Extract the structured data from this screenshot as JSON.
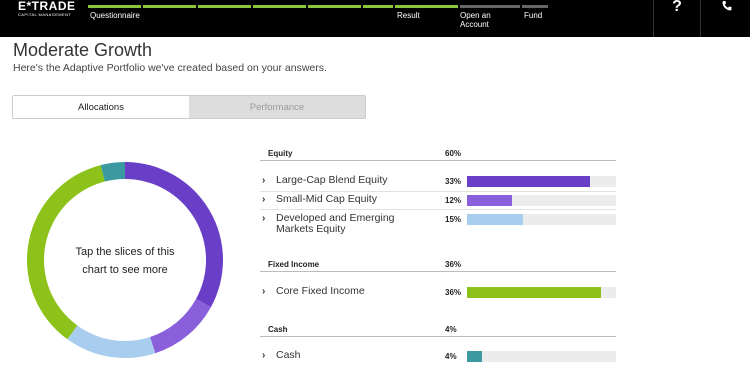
{
  "brand": {
    "name": "E*TRADE",
    "sub": "CAPITAL MANAGEMENT"
  },
  "progress": {
    "steps": [
      {
        "label": "Questionnaire",
        "state": "complete"
      },
      {
        "label": "Result",
        "state": "complete"
      },
      {
        "label": "Open an Account",
        "state": "pending"
      },
      {
        "label": "Fund",
        "state": "pending"
      }
    ]
  },
  "header": {
    "help_label": "?",
    "phone_icon": "phone-icon"
  },
  "page": {
    "title": "Moderate Growth",
    "subtitle": "Here's the Adaptive Portfolio we've created based on your answers."
  },
  "tabs": {
    "allocations": "Allocations",
    "performance": "Performance"
  },
  "donut": {
    "line1": "Tap the slices of this",
    "line2": "chart to see more"
  },
  "allocation": {
    "equity": {
      "name": "Equity",
      "pct": "60%",
      "items": [
        {
          "label": "Large-Cap Blend Equity",
          "pct": "33%",
          "value": 33,
          "color": "#6a3fc7"
        },
        {
          "label": "Small-Mid Cap Equity",
          "pct": "12%",
          "value": 12,
          "color": "#8a5fdc"
        },
        {
          "label": "Developed and Emerging Markets Equity",
          "pct": "15%",
          "value": 15,
          "color": "#a9cdef"
        }
      ]
    },
    "fixed_income": {
      "name": "Fixed Income",
      "pct": "36%",
      "items": [
        {
          "label": "Core Fixed Income",
          "pct": "36%",
          "value": 36,
          "color": "#8cc21a"
        }
      ]
    },
    "cash": {
      "name": "Cash",
      "pct": "4%",
      "items": [
        {
          "label": "Cash",
          "pct": "4%",
          "value": 4,
          "color": "#3a9aa0"
        }
      ]
    }
  },
  "colors": {
    "accent_green": "#8cc63f",
    "top_bar": "#000000"
  }
}
